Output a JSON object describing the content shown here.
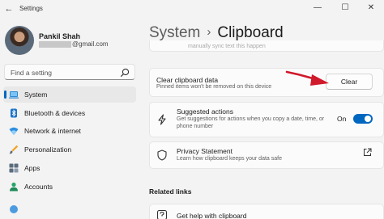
{
  "window": {
    "app_title": "Settings",
    "back_glyph": "←",
    "controls": {
      "minimize": "—",
      "maximize": "☐",
      "close": "✕"
    }
  },
  "user": {
    "name": "Pankil Shah",
    "email_suffix": "@gmail.com"
  },
  "search": {
    "placeholder": "Find a setting"
  },
  "sidebar": {
    "items": [
      {
        "label": "System",
        "icon": "laptop-icon",
        "active": true
      },
      {
        "label": "Bluetooth & devices",
        "icon": "bluetooth-icon",
        "active": false
      },
      {
        "label": "Network & internet",
        "icon": "wifi-icon",
        "active": false
      },
      {
        "label": "Personalization",
        "icon": "brush-icon",
        "active": false
      },
      {
        "label": "Apps",
        "icon": "apps-icon",
        "active": false
      },
      {
        "label": "Accounts",
        "icon": "person-icon",
        "active": false
      }
    ]
  },
  "breadcrumb": {
    "parent": "System",
    "separator": "›",
    "current": "Clipboard"
  },
  "main": {
    "faded_text": "manually sync text this happen",
    "clear_card": {
      "title": "Clear clipboard data",
      "subtitle": "Pinned items won't be removed on this device",
      "button_label": "Clear"
    },
    "suggested_card": {
      "title": "Suggested actions",
      "subtitle_line1": "Get suggestions for actions when you copy a date, time, or",
      "subtitle_line2": "phone number",
      "toggle_label": "On",
      "toggle_on": true
    },
    "privacy_card": {
      "title": "Privacy Statement",
      "subtitle": "Learn how clipboard keeps your data safe"
    },
    "related_links_heading": "Related links",
    "help_card": {
      "title": "Get help with clipboard"
    }
  },
  "colors": {
    "accent": "#0067c0",
    "arrow": "#d0192a",
    "background": "#f3f3f3",
    "card": "#fbfbfb"
  }
}
